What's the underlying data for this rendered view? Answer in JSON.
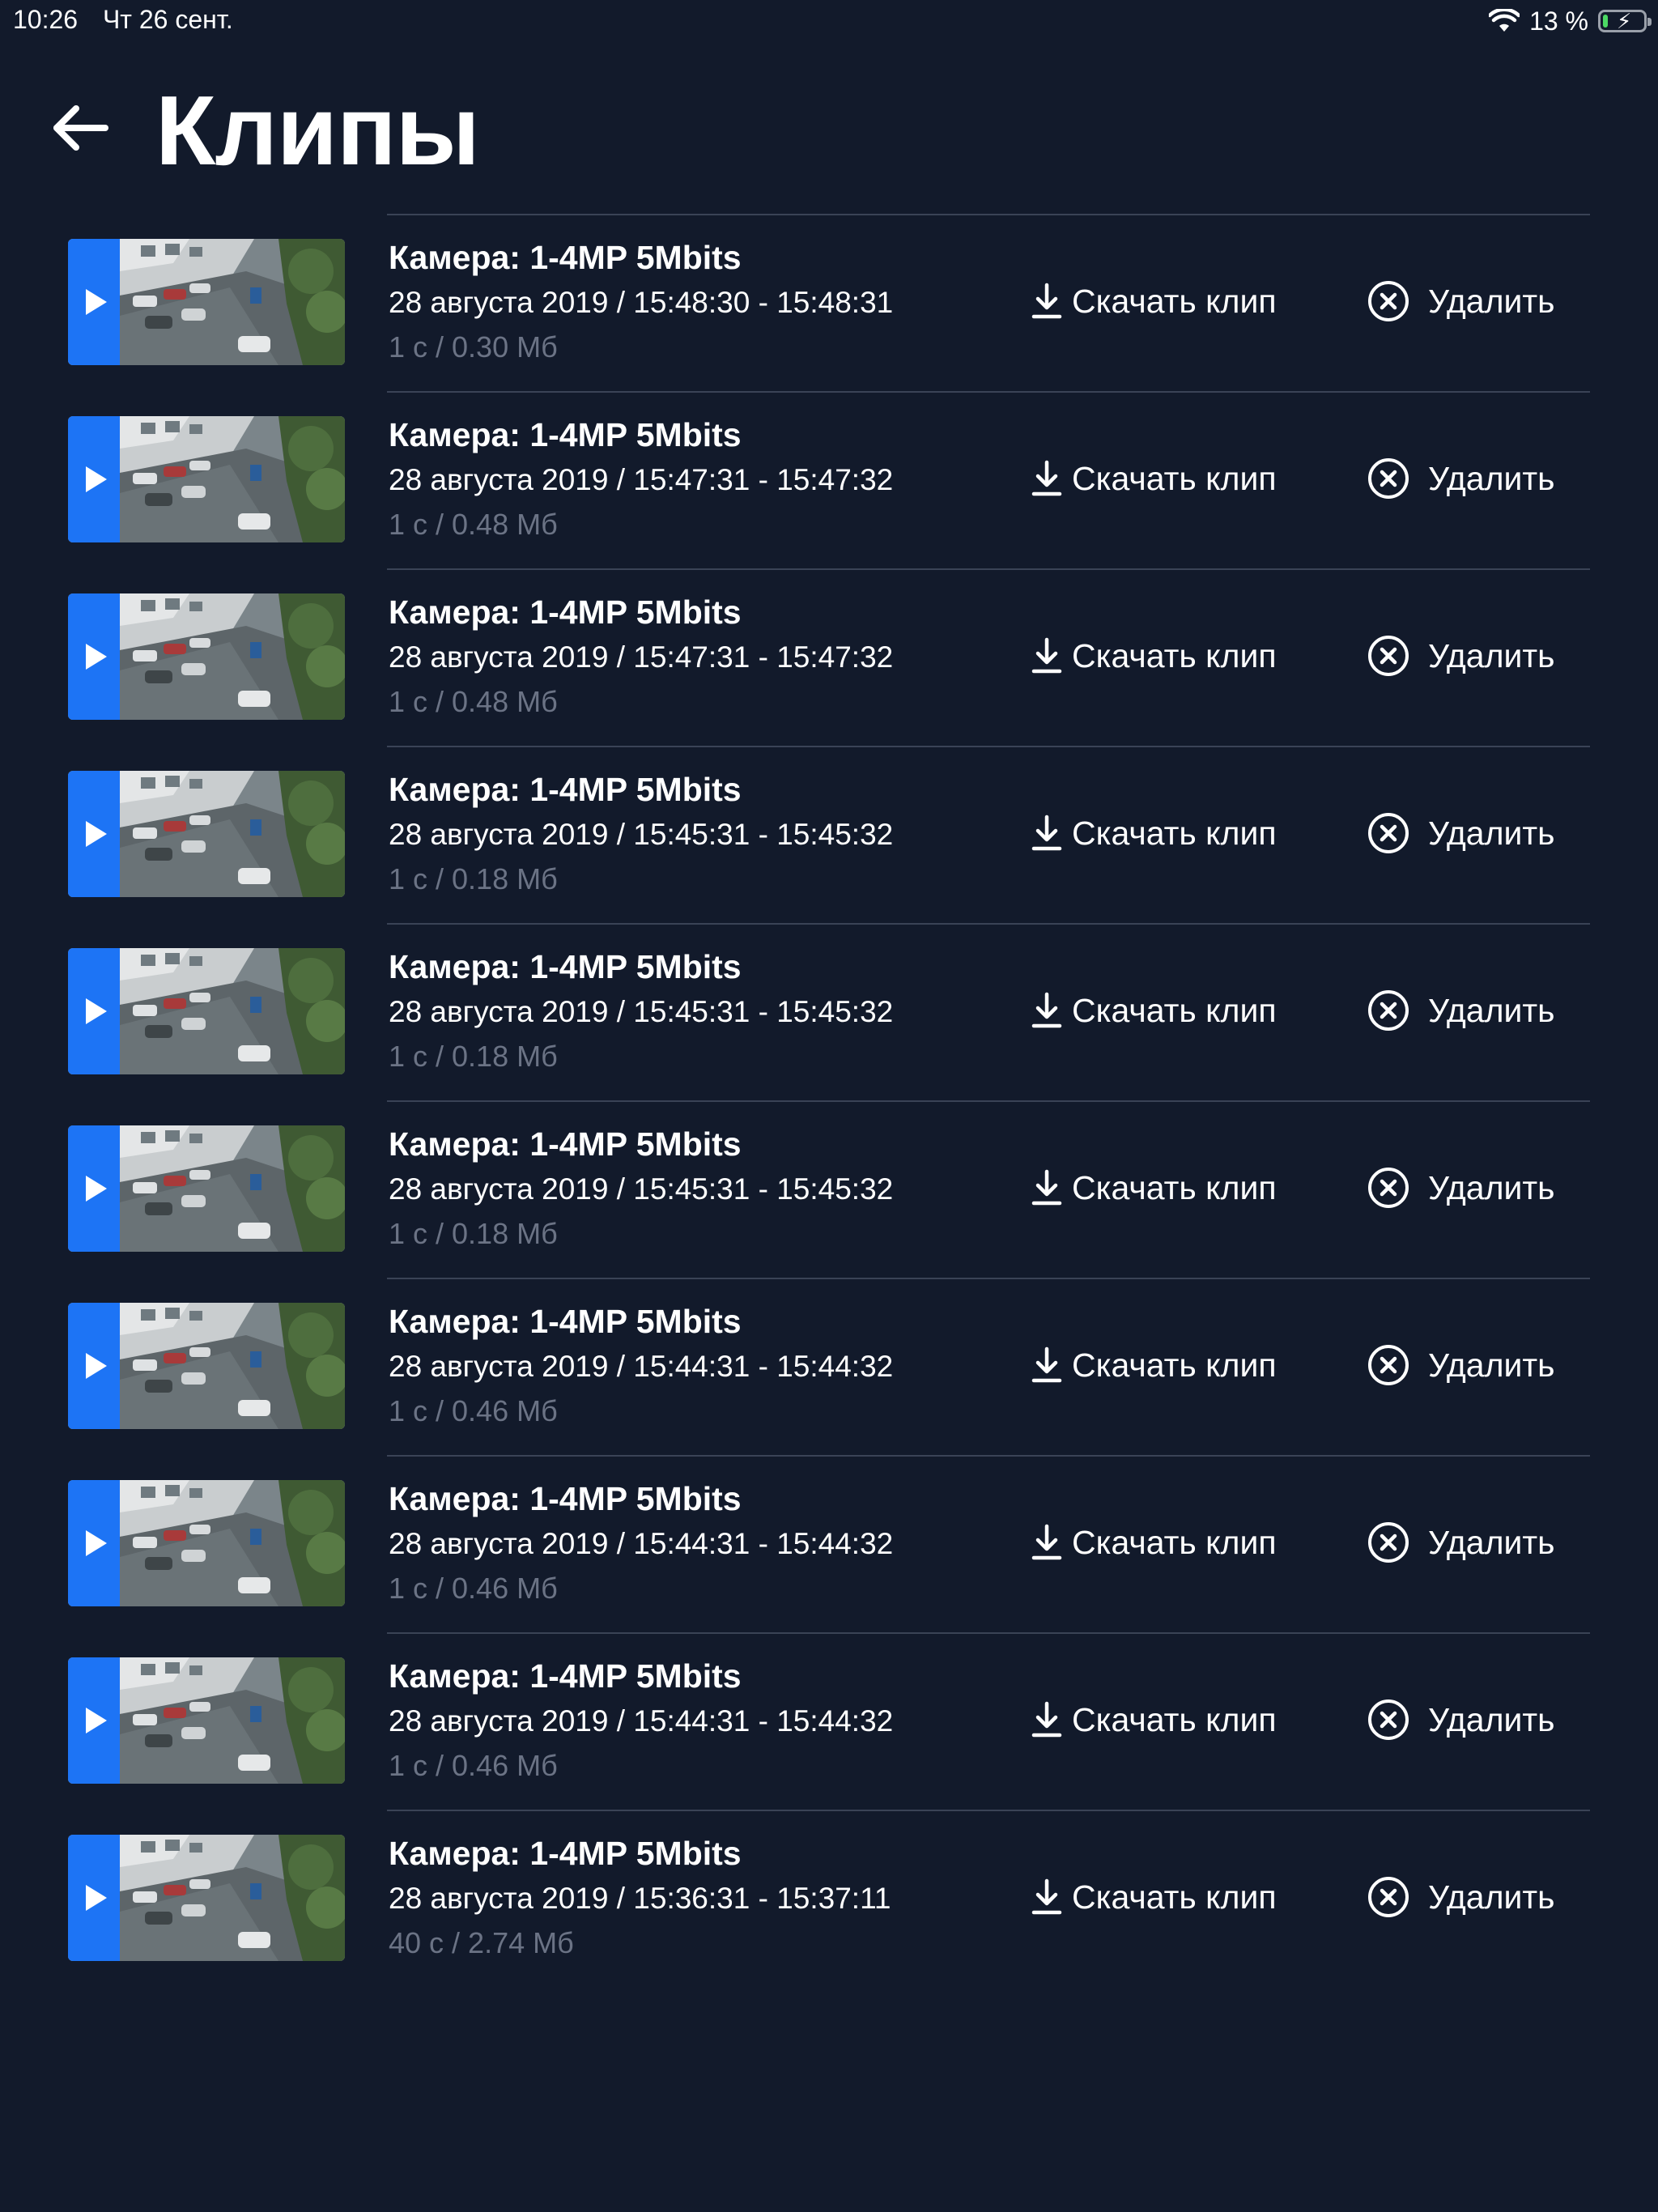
{
  "status_bar": {
    "time": "10:26",
    "date": "Чт 26 сент.",
    "battery_percent": "13 %",
    "battery_level": 0.13,
    "wifi_icon": "wifi-icon",
    "battery_icon": "battery-charging-icon"
  },
  "header": {
    "back_icon": "arrow-left-icon",
    "title": "Клипы"
  },
  "colors": {
    "background": "#121a2b",
    "accent": "#1d74f5",
    "muted_text": "#6b7385",
    "divider": "#3a4356"
  },
  "actions": {
    "download_label": "Скачать клип",
    "download_icon": "download-icon",
    "delete_label": "Удалить",
    "delete_icon": "close-circle-icon",
    "play_icon": "play-icon"
  },
  "clips": [
    {
      "camera": "Камера: 1-4MP 5Mbits",
      "date": "28 августа 2019 / 15:48:30 - 15:48:31",
      "size": "1 с / 0.30 Мб"
    },
    {
      "camera": "Камера: 1-4MP 5Mbits",
      "date": "28 августа 2019 / 15:47:31 - 15:47:32",
      "size": "1 с / 0.48 Мб"
    },
    {
      "camera": "Камера: 1-4MP 5Mbits",
      "date": "28 августа 2019 / 15:47:31 - 15:47:32",
      "size": "1 с / 0.48 Мб"
    },
    {
      "camera": "Камера: 1-4MP 5Mbits",
      "date": "28 августа 2019 / 15:45:31 - 15:45:32",
      "size": "1 с / 0.18 Мб"
    },
    {
      "camera": "Камера: 1-4MP 5Mbits",
      "date": "28 августа 2019 / 15:45:31 - 15:45:32",
      "size": "1 с / 0.18 Мб"
    },
    {
      "camera": "Камера: 1-4MP 5Mbits",
      "date": "28 августа 2019 / 15:45:31 - 15:45:32",
      "size": "1 с / 0.18 Мб"
    },
    {
      "camera": "Камера: 1-4MP 5Mbits",
      "date": "28 августа 2019 / 15:44:31 - 15:44:32",
      "size": "1 с / 0.46 Мб"
    },
    {
      "camera": "Камера: 1-4MP 5Mbits",
      "date": "28 августа 2019 / 15:44:31 - 15:44:32",
      "size": "1 с / 0.46 Мб"
    },
    {
      "camera": "Камера: 1-4MP 5Mbits",
      "date": "28 августа 2019 / 15:44:31 - 15:44:32",
      "size": "1 с / 0.46 Мб"
    },
    {
      "camera": "Камера: 1-4MP 5Mbits",
      "date": "28 августа 2019 / 15:36:31 - 15:37:11",
      "size": "40 с / 2.74 Мб"
    }
  ]
}
